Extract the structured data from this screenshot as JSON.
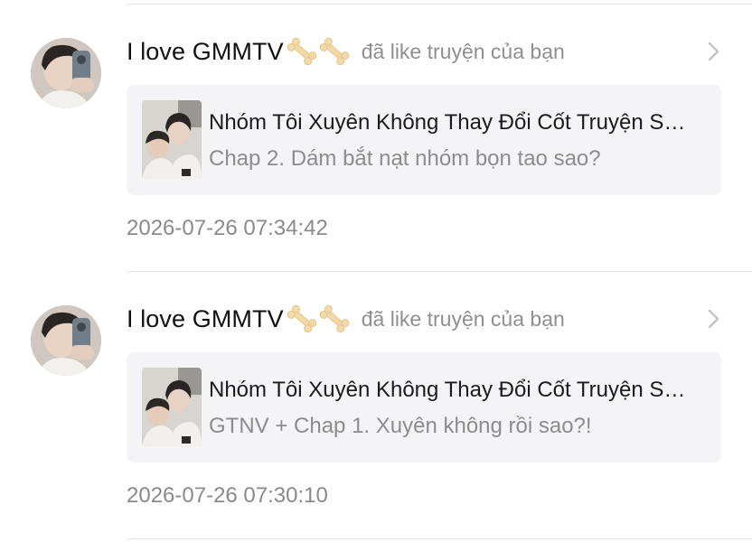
{
  "notifications": [
    {
      "username": "I love GMMTV",
      "action": "đã like truyện của bạn",
      "story_title": "Nhóm Tôi Xuyên Không Thay Đổi Cốt Truyện S…",
      "chapter": "Chap 2. Dám bắt nạt nhóm bọn tao sao?",
      "time": "2026-07-26 07:34:42"
    },
    {
      "username": "I love GMMTV",
      "action": "đã like truyện của bạn",
      "story_title": "Nhóm Tôi Xuyên Không Thay Đổi Cốt Truyện S…",
      "chapter": "GTNV + Chap 1. Xuyên không rồi sao?!",
      "time": "2026-07-26 07:30:10"
    }
  ],
  "icons": {
    "username_badge": "bone-icon",
    "row_arrow": "chevron-right-icon"
  },
  "colors": {
    "card_background": "#f4f4f6",
    "muted_text": "#8f8f8f",
    "bone": "#f3d9a6"
  }
}
